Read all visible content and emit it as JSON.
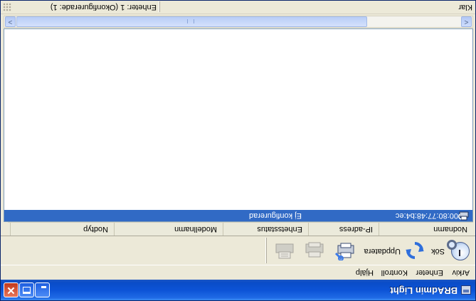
{
  "window": {
    "title": "BRAdmin Light"
  },
  "menu": {
    "items": [
      "Arkiv",
      "Enheter",
      "Kontroll",
      "Hjälp"
    ]
  },
  "toolbar": {
    "search_label": "Sök",
    "refresh_label": "Uppdatera"
  },
  "table": {
    "columns": [
      "Nodnamn",
      "IP-adress",
      "Enhetsstatus",
      "Modellnamn",
      "Nodtyp"
    ],
    "rows": [
      {
        "node_name": "00:80:77:48:b4:ec",
        "ip_address": "",
        "status": "Ej konfigurerad",
        "model": "",
        "node_type": ""
      }
    ]
  },
  "statusbar": {
    "left": "Klar",
    "right": "Enheter: 1 (Okonfigurerade: 1)"
  },
  "colors": {
    "titlebar": "#0c53d6",
    "selection": "#316ac5",
    "window_bg": "#ece9d8"
  }
}
